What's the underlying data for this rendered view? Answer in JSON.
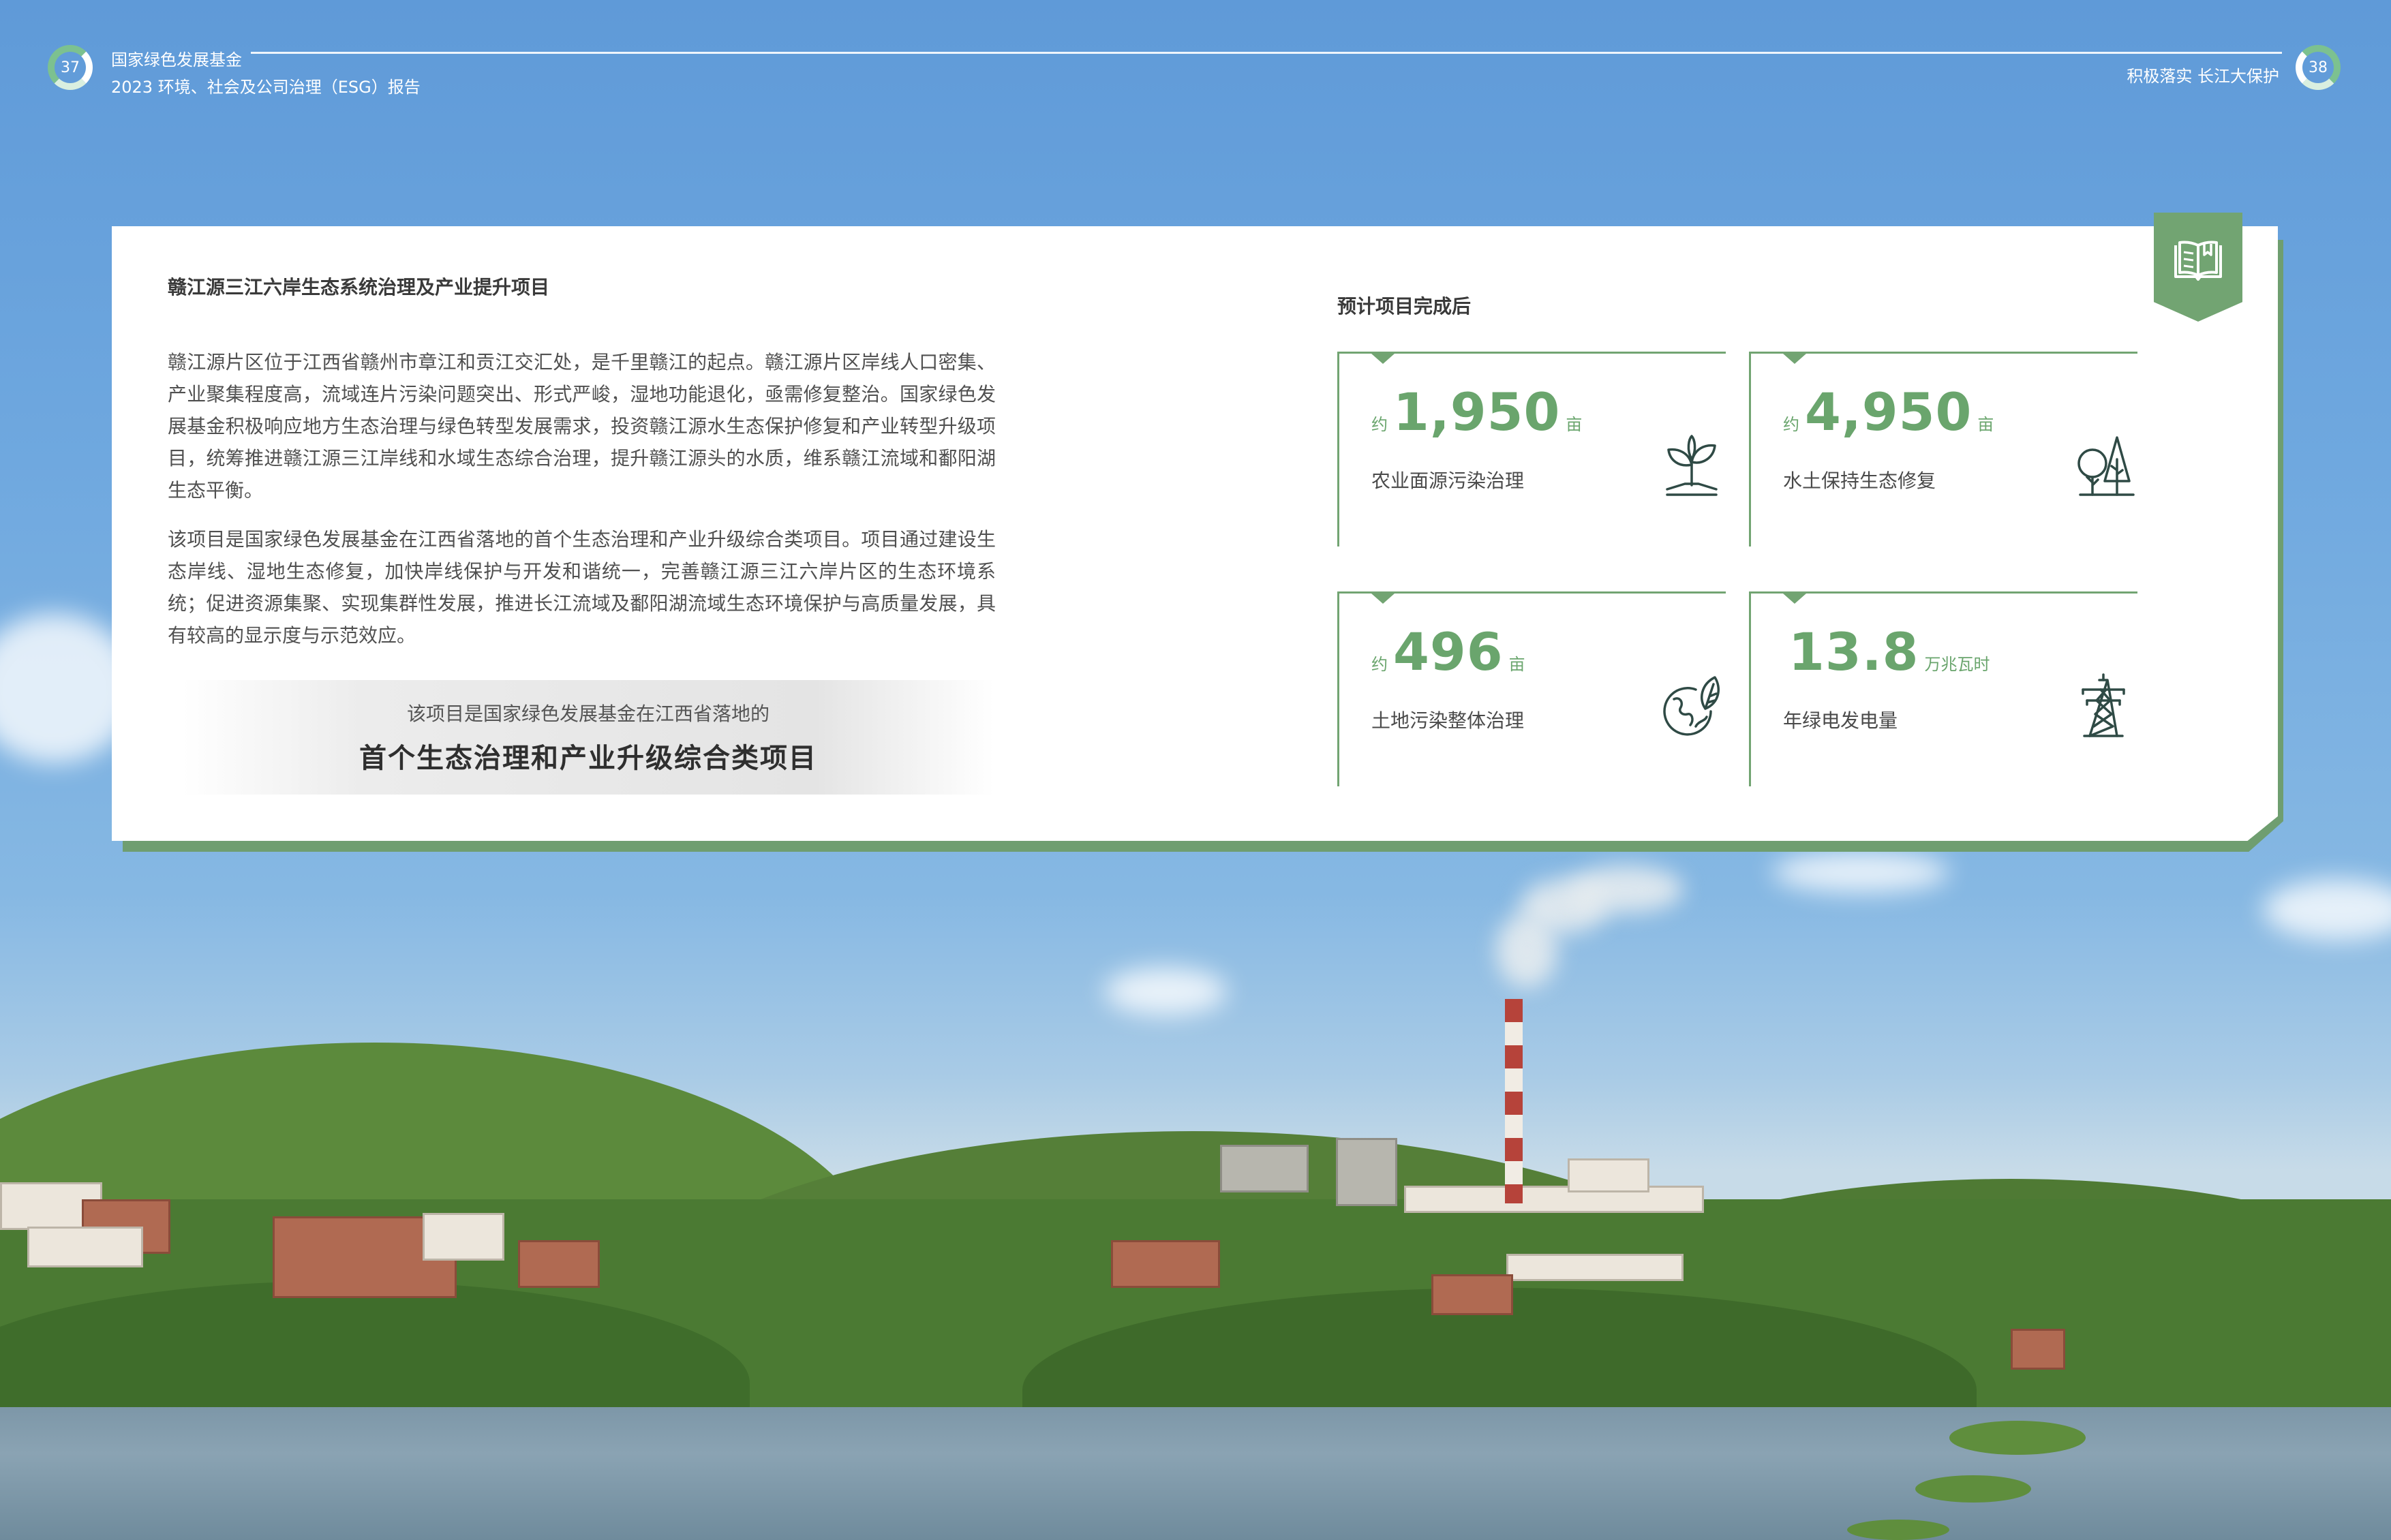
{
  "header": {
    "left_page_number": "37",
    "right_page_number": "38",
    "org_name": "国家绿色发展基金",
    "report_title": "2023 环境、社会及公司治理（ESG）报告",
    "section_title": "积极落实 长江大保护"
  },
  "project": {
    "title": "赣江源三江六岸生态系统治理及产业提升项目",
    "paragraphs": [
      "赣江源片区位于江西省赣州市章江和贡江交汇处，是千里赣江的起点。赣江源片区岸线人口密集、产业聚集程度高，流域连片污染问题突出、形式严峻，湿地功能退化，亟需修复整治。国家绿色发展基金积极响应地方生态治理与绿色转型发展需求，投资赣江源水生态保护修复和产业转型升级项目，统筹推进赣江源三江岸线和水域生态综合治理，提升赣江源头的水质，维系赣江流域和鄱阳湖生态平衡。",
      "该项目是国家绿色发展基金在江西省落地的首个生态治理和产业升级综合类项目。项目通过建设生态岸线、湿地生态修复，加快岸线保护与开发和谐统一，完善赣江源三江六岸片区的生态环境系统；促进资源集聚、实现集群性发展，推进长江流域及鄱阳湖流域生态环境保护与高质量发展，具有较高的显示度与示范效应。"
    ],
    "highlight_sub": "该项目是国家绿色发展基金在江西省落地的",
    "highlight_main": "首个生态治理和产业升级综合类项目"
  },
  "stats": {
    "heading": "预计项目完成后",
    "items": [
      {
        "prefix": "约",
        "value": "1,950",
        "unit": "亩",
        "label": "农业面源污染治理",
        "icon": "seedling-icon"
      },
      {
        "prefix": "约",
        "value": "4,950",
        "unit": "亩",
        "label": "水土保持生态修复",
        "icon": "trees-icon"
      },
      {
        "prefix": "约",
        "value": "496",
        "unit": "亩",
        "label": "土地污染整体治理",
        "icon": "globe-leaf-icon"
      },
      {
        "prefix": "",
        "value": "13.8",
        "unit": "万兆瓦时",
        "label": "年绿电发电量",
        "icon": "power-tower-icon"
      }
    ]
  },
  "colors": {
    "accent_green": "#6aa56d",
    "card_shadow": "#6f9e70"
  }
}
